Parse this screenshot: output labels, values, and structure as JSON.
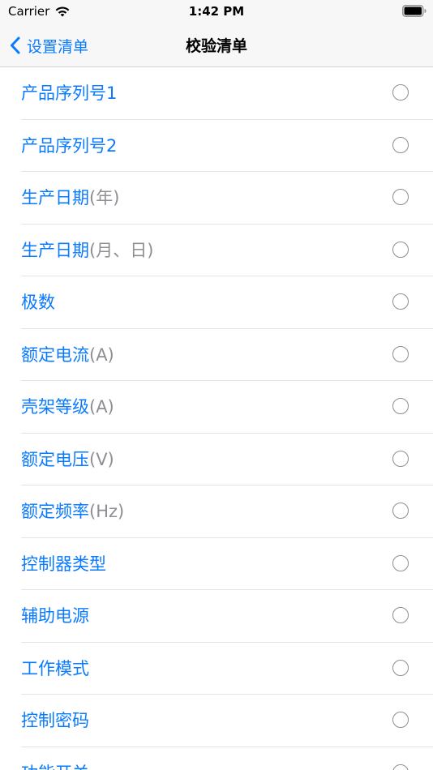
{
  "status_bar": {
    "carrier": "Carrier",
    "time": "1:42 PM"
  },
  "nav": {
    "back_label": "设置清单",
    "title": "校验清单"
  },
  "colors": {
    "accent": "#0a7aff",
    "unit_gray": "#8e8e93",
    "bar_bg": "#f7f7f7"
  },
  "items": [
    {
      "label": "产品序列号1",
      "unit": "",
      "checked": false
    },
    {
      "label": "产品序列号2",
      "unit": "",
      "checked": false
    },
    {
      "label": "生产日期",
      "unit": "(年)",
      "checked": false
    },
    {
      "label": "生产日期",
      "unit": "(月、日)",
      "checked": false
    },
    {
      "label": "极数",
      "unit": "",
      "checked": false
    },
    {
      "label": "额定电流",
      "unit": "(A)",
      "checked": false
    },
    {
      "label": "壳架等级",
      "unit": "(A)",
      "checked": false
    },
    {
      "label": "额定电压",
      "unit": "(V)",
      "checked": false
    },
    {
      "label": "额定频率",
      "unit": "(Hz)",
      "checked": false
    },
    {
      "label": "控制器类型",
      "unit": "",
      "checked": false
    },
    {
      "label": "辅助电源",
      "unit": "",
      "checked": false
    },
    {
      "label": "工作模式",
      "unit": "",
      "checked": false
    },
    {
      "label": "控制密码",
      "unit": "",
      "checked": false
    },
    {
      "label": "功能开关",
      "unit": "",
      "checked": false
    }
  ]
}
